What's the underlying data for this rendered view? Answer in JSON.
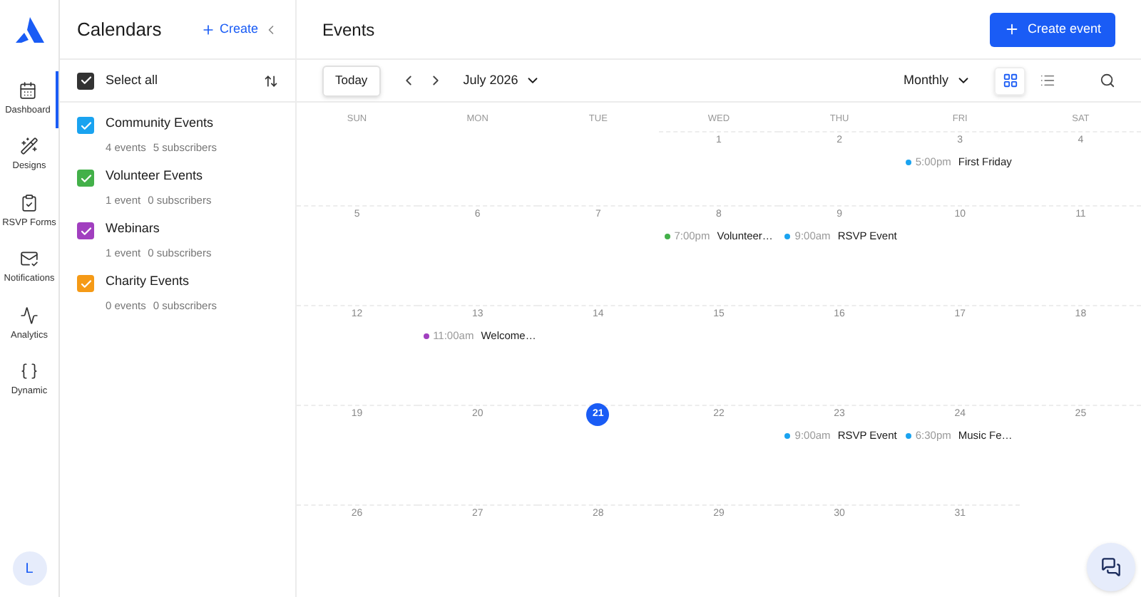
{
  "nav": {
    "avatar": "L",
    "items": [
      {
        "kind": "calendar",
        "label": "Dashboard",
        "selected": true
      },
      {
        "kind": "designs",
        "label": "Designs",
        "selected": false
      },
      {
        "kind": "forms",
        "label": "RSVP Forms",
        "selected": false
      },
      {
        "kind": "mail",
        "label": "Notifications",
        "selected": false
      },
      {
        "kind": "analytics",
        "label": "Analytics",
        "selected": false
      },
      {
        "kind": "braces",
        "label": "Dynamic",
        "selected": false
      }
    ]
  },
  "calendars_panel": {
    "title": "Calendars",
    "create": "Create",
    "select_all": {
      "label": "Select all",
      "checked": true
    },
    "calendars": [
      {
        "name": "Community Events",
        "events": "4 events",
        "subscribers": "5 subscribers",
        "color": "#1aa3f0",
        "checked": true
      },
      {
        "name": "Volunteer Events",
        "events": "1 event",
        "subscribers": "0 subscribers",
        "color": "#43b049",
        "checked": true
      },
      {
        "name": "Webinars",
        "events": "1 event",
        "subscribers": "0 subscribers",
        "color": "#a13fbf",
        "checked": true
      },
      {
        "name": "Charity Events",
        "events": "0 events",
        "subscribers": "0 subscribers",
        "color": "#f59a16",
        "checked": true
      }
    ]
  },
  "main": {
    "title": "Events",
    "create_button": "Create event",
    "today_button": "Today",
    "month": "July 2026",
    "view_mode": "Monthly",
    "views": [
      {
        "kind": "grid",
        "selected": true
      },
      {
        "kind": "list",
        "selected": false
      }
    ],
    "weekdays": [
      "SUN",
      "MON",
      "TUE",
      "WED",
      "THU",
      "FRI",
      "SAT"
    ],
    "weeks": [
      [
        {
          "kind": "blank"
        },
        {
          "kind": "blank"
        },
        {
          "kind": "blank"
        },
        {
          "date": "1",
          "today": false
        },
        {
          "date": "2",
          "today": false
        },
        {
          "date": "3",
          "today": false,
          "events": [
            {
              "time": "5:00pm",
              "title": "First Friday",
              "color": "#1aa3f0"
            }
          ]
        },
        {
          "date": "4",
          "today": false
        }
      ],
      [
        {
          "date": "5",
          "today": false
        },
        {
          "date": "6",
          "today": false
        },
        {
          "date": "7",
          "today": false
        },
        {
          "date": "8",
          "today": false,
          "events": [
            {
              "time": "7:00pm",
              "title": "Volunteer…",
              "color": "#43b049"
            }
          ]
        },
        {
          "date": "9",
          "today": false,
          "events": [
            {
              "time": "9:00am",
              "title": "RSVP Event",
              "color": "#1aa3f0"
            }
          ]
        },
        {
          "date": "10",
          "today": false
        },
        {
          "date": "11",
          "today": false
        }
      ],
      [
        {
          "date": "12",
          "today": false
        },
        {
          "date": "13",
          "today": false,
          "events": [
            {
              "time": "11:00am",
              "title": "Welcome…",
              "color": "#a13fbf"
            }
          ]
        },
        {
          "date": "14",
          "today": false
        },
        {
          "date": "15",
          "today": false
        },
        {
          "date": "16",
          "today": false
        },
        {
          "date": "17",
          "today": false
        },
        {
          "date": "18",
          "today": false
        }
      ],
      [
        {
          "date": "19",
          "today": false
        },
        {
          "date": "20",
          "today": false
        },
        {
          "date": "21",
          "today": true
        },
        {
          "date": "22",
          "today": false
        },
        {
          "date": "23",
          "today": false,
          "events": [
            {
              "time": "9:00am",
              "title": "RSVP Event",
              "color": "#1aa3f0"
            }
          ]
        },
        {
          "date": "24",
          "today": false,
          "events": [
            {
              "time": "6:30pm",
              "title": "Music Fe…",
              "color": "#1aa3f0"
            }
          ]
        },
        {
          "date": "25",
          "today": false
        }
      ],
      [
        {
          "date": "26",
          "today": false
        },
        {
          "date": "27",
          "today": false
        },
        {
          "date": "28",
          "today": false
        },
        {
          "date": "29",
          "today": false
        },
        {
          "date": "30",
          "today": false
        },
        {
          "date": "31",
          "today": false
        },
        {
          "kind": "blank"
        }
      ]
    ]
  }
}
